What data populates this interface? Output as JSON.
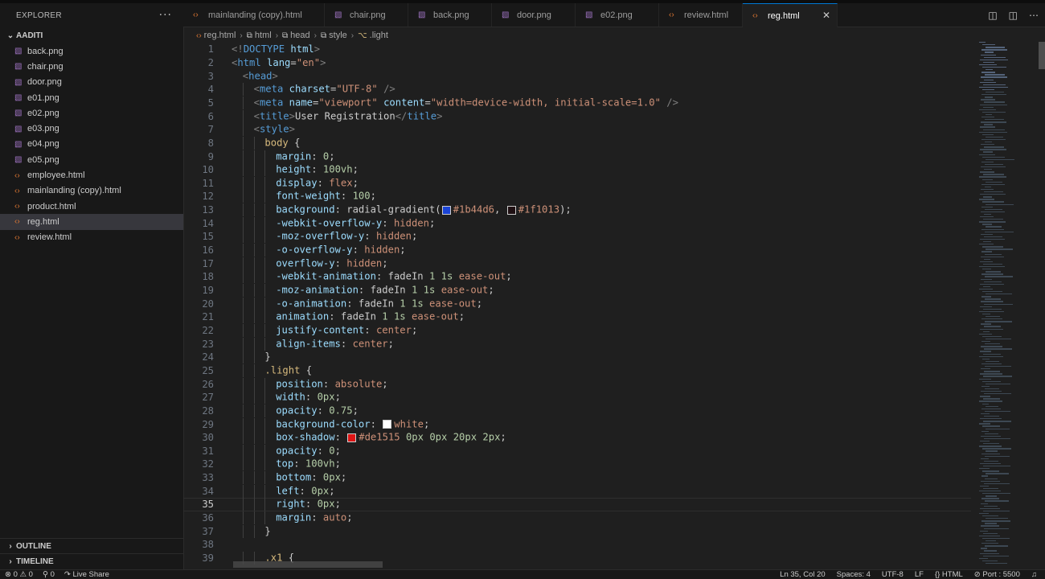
{
  "explorer": {
    "title": "EXPLORER",
    "more": "···",
    "folder": "AADITI",
    "files": [
      {
        "name": "back.png",
        "kind": "img"
      },
      {
        "name": "chair.png",
        "kind": "img"
      },
      {
        "name": "door.png",
        "kind": "img"
      },
      {
        "name": "e01.png",
        "kind": "img"
      },
      {
        "name": "e02.png",
        "kind": "img"
      },
      {
        "name": "e03.png",
        "kind": "img"
      },
      {
        "name": "e04.png",
        "kind": "img"
      },
      {
        "name": "e05.png",
        "kind": "img"
      },
      {
        "name": "employee.html",
        "kind": "html"
      },
      {
        "name": "mainlanding (copy).html",
        "kind": "html"
      },
      {
        "name": "product.html",
        "kind": "html"
      },
      {
        "name": "reg.html",
        "kind": "html",
        "active": true
      },
      {
        "name": "review.html",
        "kind": "html"
      }
    ],
    "outline": "OUTLINE",
    "timeline": "TIMELINE"
  },
  "tabs": [
    {
      "label": "mainlanding (copy).html",
      "kind": "html"
    },
    {
      "label": "chair.png",
      "kind": "img"
    },
    {
      "label": "back.png",
      "kind": "img"
    },
    {
      "label": "door.png",
      "kind": "img"
    },
    {
      "label": "e02.png",
      "kind": "img"
    },
    {
      "label": "review.html",
      "kind": "html"
    },
    {
      "label": "reg.html",
      "kind": "html",
      "active": true
    }
  ],
  "breadcrumb": [
    "reg.html",
    "html",
    "head",
    "style",
    ".light"
  ],
  "editor": {
    "current_line": 35,
    "lines": [
      {
        "n": 1,
        "indent": 0,
        "tokens": [
          [
            "bk",
            "<!"
          ],
          [
            "tag",
            "DOCTYPE"
          ],
          [
            "txt",
            " "
          ],
          [
            "attr",
            "html"
          ],
          [
            "bk",
            ">"
          ]
        ]
      },
      {
        "n": 2,
        "indent": 0,
        "tokens": [
          [
            "bk",
            "<"
          ],
          [
            "tag",
            "html"
          ],
          [
            "txt",
            " "
          ],
          [
            "attr",
            "lang"
          ],
          [
            "txt",
            "="
          ],
          [
            "str",
            "\"en\""
          ],
          [
            "bk",
            ">"
          ]
        ]
      },
      {
        "n": 3,
        "indent": 1,
        "tokens": [
          [
            "bk",
            "<"
          ],
          [
            "tag",
            "head"
          ],
          [
            "bk",
            ">"
          ]
        ]
      },
      {
        "n": 4,
        "indent": 2,
        "tokens": [
          [
            "bk",
            "<"
          ],
          [
            "tag",
            "meta"
          ],
          [
            "txt",
            " "
          ],
          [
            "attr",
            "charset"
          ],
          [
            "txt",
            "="
          ],
          [
            "str",
            "\"UTF-8\""
          ],
          [
            "txt",
            " "
          ],
          [
            "bk",
            "/>"
          ]
        ]
      },
      {
        "n": 5,
        "indent": 2,
        "tokens": [
          [
            "bk",
            "<"
          ],
          [
            "tag",
            "meta"
          ],
          [
            "txt",
            " "
          ],
          [
            "attr",
            "name"
          ],
          [
            "txt",
            "="
          ],
          [
            "str",
            "\"viewport\""
          ],
          [
            "txt",
            " "
          ],
          [
            "attr",
            "content"
          ],
          [
            "txt",
            "="
          ],
          [
            "str",
            "\"width=device-width, initial-scale=1.0\""
          ],
          [
            "txt",
            " "
          ],
          [
            "bk",
            "/>"
          ]
        ]
      },
      {
        "n": 6,
        "indent": 2,
        "tokens": [
          [
            "bk",
            "<"
          ],
          [
            "tag",
            "title"
          ],
          [
            "bk",
            ">"
          ],
          [
            "txt",
            "User Registration"
          ],
          [
            "bk",
            "</"
          ],
          [
            "tag",
            "title"
          ],
          [
            "bk",
            ">"
          ]
        ]
      },
      {
        "n": 7,
        "indent": 2,
        "tokens": [
          [
            "bk",
            "<"
          ],
          [
            "tag",
            "style"
          ],
          [
            "bk",
            ">"
          ]
        ]
      },
      {
        "n": 8,
        "indent": 3,
        "tokens": [
          [
            "sel",
            "body"
          ],
          [
            "txt",
            " {"
          ]
        ]
      },
      {
        "n": 9,
        "indent": 4,
        "tokens": [
          [
            "prop",
            "margin"
          ],
          [
            "txt",
            ": "
          ],
          [
            "num",
            "0"
          ],
          [
            "txt",
            ";"
          ]
        ]
      },
      {
        "n": 10,
        "indent": 4,
        "tokens": [
          [
            "prop",
            "height"
          ],
          [
            "txt",
            ": "
          ],
          [
            "num",
            "100vh"
          ],
          [
            "txt",
            ";"
          ]
        ]
      },
      {
        "n": 11,
        "indent": 4,
        "tokens": [
          [
            "prop",
            "display"
          ],
          [
            "txt",
            ": "
          ],
          [
            "kw",
            "flex"
          ],
          [
            "txt",
            ";"
          ]
        ]
      },
      {
        "n": 12,
        "indent": 4,
        "tokens": [
          [
            "prop",
            "font-weight"
          ],
          [
            "txt",
            ": "
          ],
          [
            "num",
            "100"
          ],
          [
            "txt",
            ";"
          ]
        ]
      },
      {
        "n": 13,
        "indent": 4,
        "tokens": [
          [
            "prop",
            "background"
          ],
          [
            "txt",
            ": radial-gradient("
          ],
          [
            "swatch",
            "#1b44d6"
          ],
          [
            "kw",
            "#1b44d6"
          ],
          [
            "txt",
            ", "
          ],
          [
            "swatch",
            "#1f1013"
          ],
          [
            "kw",
            "#1f1013"
          ],
          [
            "txt",
            ");"
          ]
        ]
      },
      {
        "n": 14,
        "indent": 4,
        "tokens": [
          [
            "prop",
            "-webkit-overflow-y"
          ],
          [
            "txt",
            ": "
          ],
          [
            "kw",
            "hidden"
          ],
          [
            "txt",
            ";"
          ]
        ]
      },
      {
        "n": 15,
        "indent": 4,
        "tokens": [
          [
            "prop",
            "-moz-overflow-y"
          ],
          [
            "txt",
            ": "
          ],
          [
            "kw",
            "hidden"
          ],
          [
            "txt",
            ";"
          ]
        ]
      },
      {
        "n": 16,
        "indent": 4,
        "tokens": [
          [
            "prop",
            "-o-overflow-y"
          ],
          [
            "txt",
            ": "
          ],
          [
            "kw",
            "hidden"
          ],
          [
            "txt",
            ";"
          ]
        ]
      },
      {
        "n": 17,
        "indent": 4,
        "tokens": [
          [
            "prop",
            "overflow-y"
          ],
          [
            "txt",
            ": "
          ],
          [
            "kw",
            "hidden"
          ],
          [
            "txt",
            ";"
          ]
        ]
      },
      {
        "n": 18,
        "indent": 4,
        "tokens": [
          [
            "prop",
            "-webkit-animation"
          ],
          [
            "txt",
            ": fadeIn "
          ],
          [
            "num",
            "1"
          ],
          [
            "txt",
            " "
          ],
          [
            "num",
            "1s"
          ],
          [
            "txt",
            " "
          ],
          [
            "kw",
            "ease-out"
          ],
          [
            "txt",
            ";"
          ]
        ]
      },
      {
        "n": 19,
        "indent": 4,
        "tokens": [
          [
            "prop",
            "-moz-animation"
          ],
          [
            "txt",
            ": fadeIn "
          ],
          [
            "num",
            "1"
          ],
          [
            "txt",
            " "
          ],
          [
            "num",
            "1s"
          ],
          [
            "txt",
            " "
          ],
          [
            "kw",
            "ease-out"
          ],
          [
            "txt",
            ";"
          ]
        ]
      },
      {
        "n": 20,
        "indent": 4,
        "tokens": [
          [
            "prop",
            "-o-animation"
          ],
          [
            "txt",
            ": fadeIn "
          ],
          [
            "num",
            "1"
          ],
          [
            "txt",
            " "
          ],
          [
            "num",
            "1s"
          ],
          [
            "txt",
            " "
          ],
          [
            "kw",
            "ease-out"
          ],
          [
            "txt",
            ";"
          ]
        ]
      },
      {
        "n": 21,
        "indent": 4,
        "tokens": [
          [
            "prop",
            "animation"
          ],
          [
            "txt",
            ": fadeIn "
          ],
          [
            "num",
            "1"
          ],
          [
            "txt",
            " "
          ],
          [
            "num",
            "1s"
          ],
          [
            "txt",
            " "
          ],
          [
            "kw",
            "ease-out"
          ],
          [
            "txt",
            ";"
          ]
        ]
      },
      {
        "n": 22,
        "indent": 4,
        "tokens": [
          [
            "prop",
            "justify-content"
          ],
          [
            "txt",
            ": "
          ],
          [
            "kw",
            "center"
          ],
          [
            "txt",
            ";"
          ]
        ]
      },
      {
        "n": 23,
        "indent": 4,
        "tokens": [
          [
            "prop",
            "align-items"
          ],
          [
            "txt",
            ": "
          ],
          [
            "kw",
            "center"
          ],
          [
            "txt",
            ";"
          ]
        ]
      },
      {
        "n": 24,
        "indent": 3,
        "tokens": [
          [
            "txt",
            "}"
          ]
        ]
      },
      {
        "n": 25,
        "indent": 3,
        "tokens": [
          [
            "sel",
            ".light"
          ],
          [
            "txt",
            " {"
          ]
        ]
      },
      {
        "n": 26,
        "indent": 4,
        "tokens": [
          [
            "prop",
            "position"
          ],
          [
            "txt",
            ": "
          ],
          [
            "kw",
            "absolute"
          ],
          [
            "txt",
            ";"
          ]
        ]
      },
      {
        "n": 27,
        "indent": 4,
        "tokens": [
          [
            "prop",
            "width"
          ],
          [
            "txt",
            ": "
          ],
          [
            "num",
            "0px"
          ],
          [
            "txt",
            ";"
          ]
        ]
      },
      {
        "n": 28,
        "indent": 4,
        "tokens": [
          [
            "prop",
            "opacity"
          ],
          [
            "txt",
            ": "
          ],
          [
            "num",
            "0.75"
          ],
          [
            "txt",
            ";"
          ]
        ]
      },
      {
        "n": 29,
        "indent": 4,
        "tokens": [
          [
            "prop",
            "background-color"
          ],
          [
            "txt",
            ": "
          ],
          [
            "swatch",
            "#ffffff"
          ],
          [
            "kw",
            "white"
          ],
          [
            "txt",
            ";"
          ]
        ]
      },
      {
        "n": 30,
        "indent": 4,
        "tokens": [
          [
            "prop",
            "box-shadow"
          ],
          [
            "txt",
            ": "
          ],
          [
            "swatch",
            "#de1515"
          ],
          [
            "kw",
            "#de1515"
          ],
          [
            "txt",
            " "
          ],
          [
            "num",
            "0px"
          ],
          [
            "txt",
            " "
          ],
          [
            "num",
            "0px"
          ],
          [
            "txt",
            " "
          ],
          [
            "num",
            "20px"
          ],
          [
            "txt",
            " "
          ],
          [
            "num",
            "2px"
          ],
          [
            "txt",
            ";"
          ]
        ]
      },
      {
        "n": 31,
        "indent": 4,
        "tokens": [
          [
            "prop",
            "opacity"
          ],
          [
            "txt",
            ": "
          ],
          [
            "num",
            "0"
          ],
          [
            "txt",
            ";"
          ]
        ]
      },
      {
        "n": 32,
        "indent": 4,
        "tokens": [
          [
            "prop",
            "top"
          ],
          [
            "txt",
            ": "
          ],
          [
            "num",
            "100vh"
          ],
          [
            "txt",
            ";"
          ]
        ]
      },
      {
        "n": 33,
        "indent": 4,
        "tokens": [
          [
            "prop",
            "bottom"
          ],
          [
            "txt",
            ": "
          ],
          [
            "num",
            "0px"
          ],
          [
            "txt",
            ";"
          ]
        ]
      },
      {
        "n": 34,
        "indent": 4,
        "tokens": [
          [
            "prop",
            "left"
          ],
          [
            "txt",
            ": "
          ],
          [
            "num",
            "0px"
          ],
          [
            "txt",
            ";"
          ]
        ]
      },
      {
        "n": 35,
        "indent": 4,
        "tokens": [
          [
            "prop",
            "right"
          ],
          [
            "txt",
            ": "
          ],
          [
            "num",
            "0px"
          ],
          [
            "txt",
            ";"
          ]
        ]
      },
      {
        "n": 36,
        "indent": 4,
        "tokens": [
          [
            "prop",
            "margin"
          ],
          [
            "txt",
            ": "
          ],
          [
            "kw",
            "auto"
          ],
          [
            "txt",
            ";"
          ]
        ]
      },
      {
        "n": 37,
        "indent": 3,
        "tokens": [
          [
            "txt",
            "}"
          ]
        ]
      },
      {
        "n": 38,
        "indent": 0,
        "tokens": []
      },
      {
        "n": 39,
        "indent": 3,
        "tokens": [
          [
            "sel",
            ".x1"
          ],
          [
            "txt",
            " {"
          ]
        ]
      }
    ]
  },
  "status": {
    "errors": "⊗ 0 ⚠ 0",
    "ports": "⚲ 0",
    "live_share": "Live Share",
    "position": "Ln 35, Col 20",
    "spaces": "Spaces: 4",
    "encoding": "UTF-8",
    "eol": "LF",
    "language": "{} HTML",
    "port": "⊘ Port : 5500"
  }
}
